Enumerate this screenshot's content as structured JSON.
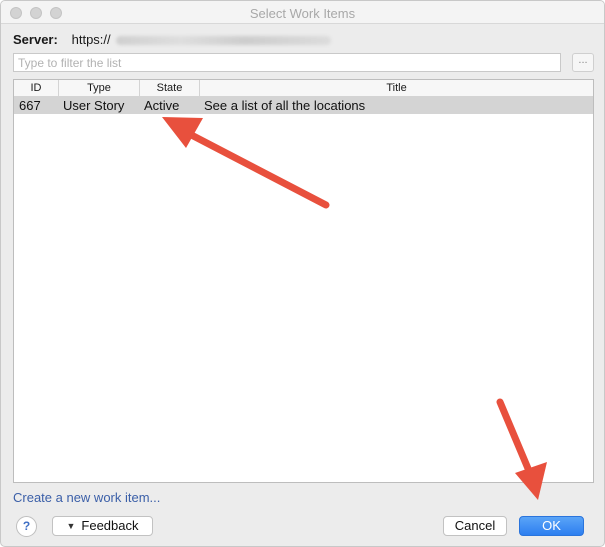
{
  "window": {
    "title": "Select Work Items"
  },
  "server": {
    "label": "Server:",
    "value": "https://"
  },
  "filter": {
    "placeholder": "Type to filter the list",
    "value": ""
  },
  "more_button": {
    "label": "..."
  },
  "table": {
    "columns": [
      "ID",
      "Type",
      "State",
      "Title"
    ],
    "rows": [
      {
        "id": "667",
        "type": "User Story",
        "state": "Active",
        "title": "See a list of all the locations"
      }
    ]
  },
  "footer": {
    "create_link": "Create a new work item...",
    "help_label": "?",
    "feedback_label": "Feedback",
    "cancel_label": "Cancel",
    "ok_label": "OK"
  },
  "colors": {
    "accent": "#2d7ff0",
    "annotation_arrow": "#e8503d",
    "selected_row": "#d4d4d4"
  },
  "icons": {
    "feedback": "triangle-down-icon",
    "help": "question-icon"
  }
}
